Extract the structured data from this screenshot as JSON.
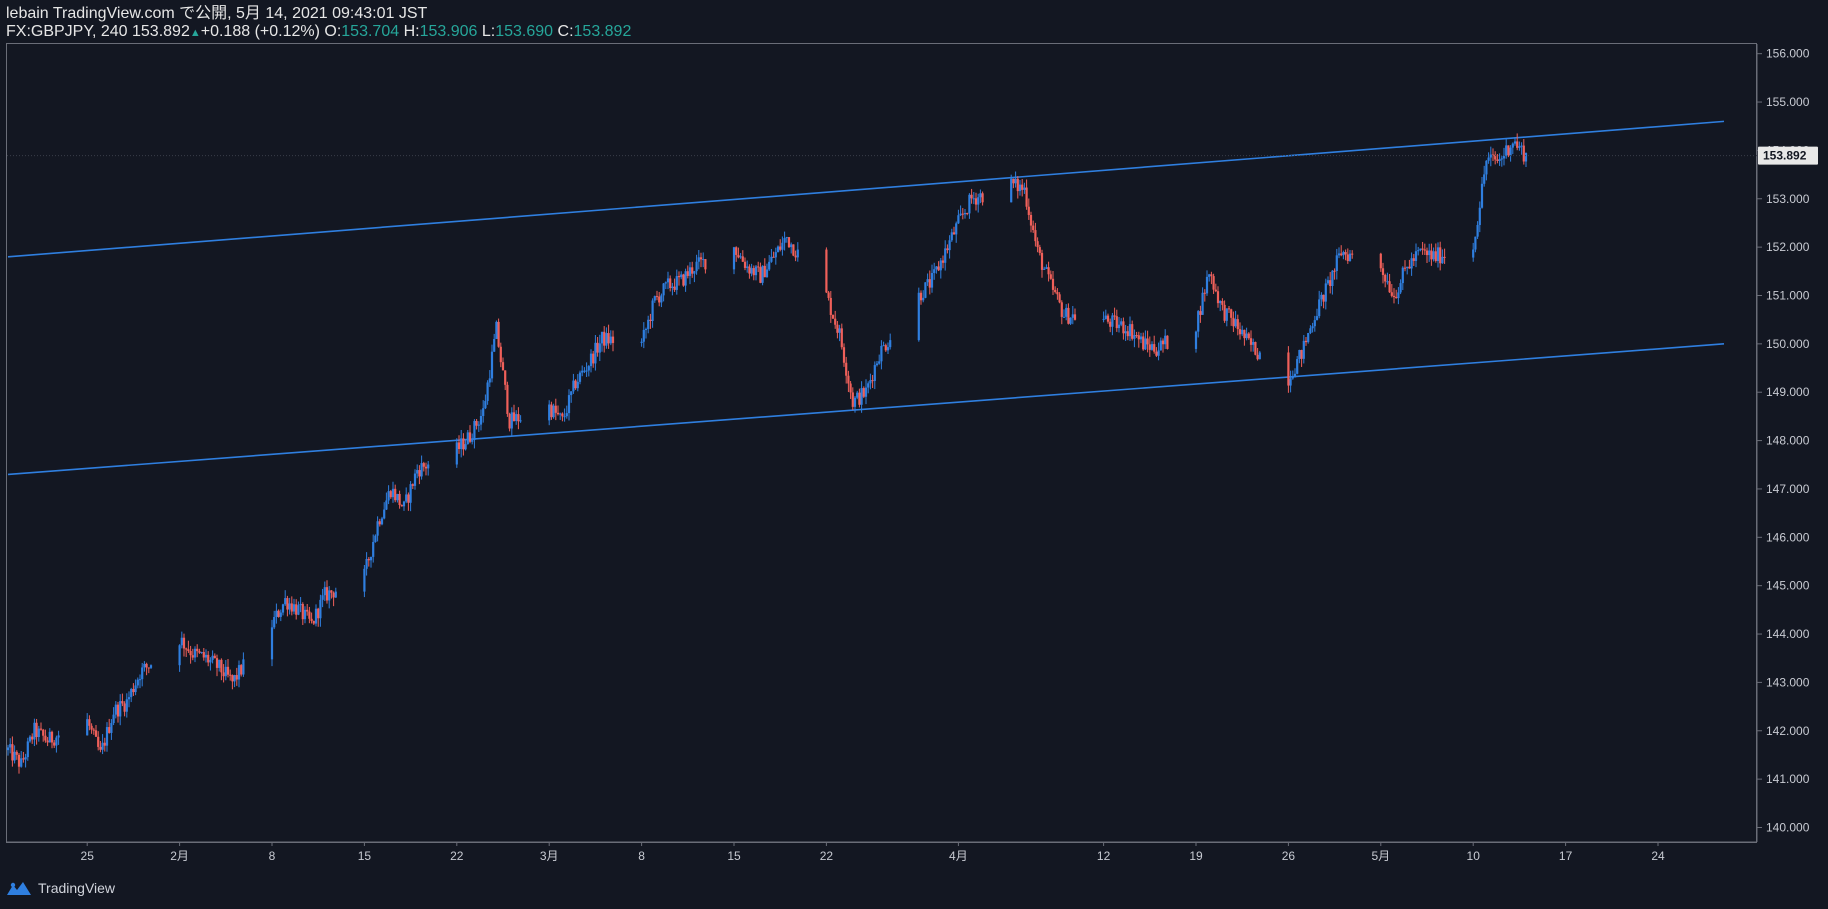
{
  "header": {
    "line1": "lebain TradingView.com で公開, 5月 14, 2021 09:43:01 JST",
    "symbol": "FX:GBPJPY, 240 ",
    "last_price": "153.892",
    "up_arrow": "▲",
    "change": "+0.188 (+0.12%)",
    "o_label": " O:",
    "o_value": "153.704",
    "h_label": " H:",
    "h_value": "153.906",
    "l_label": " L:",
    "l_value": "153.690",
    "c_label": " C:",
    "c_value": "153.892"
  },
  "footer": {
    "brand": "TradingView",
    "logo_icon": "tradingview-logo-icon"
  },
  "colors": {
    "background": "#131722",
    "up": "#2f7fe0",
    "down": "#f0605a",
    "channel": "#2f7fe0",
    "axis_border": "#6a6d78"
  },
  "chart_data": {
    "type": "candlestick",
    "symbol": "FX:GBPJPY",
    "timeframe": "240",
    "ylim": [
      139.7,
      156.2
    ],
    "y_ticks": [
      140,
      141,
      142,
      143,
      144,
      145,
      146,
      147,
      148,
      149,
      150,
      151,
      152,
      153,
      154,
      155,
      156
    ],
    "y_tick_labels": [
      "140.000",
      "141.000",
      "142.000",
      "143.000",
      "144.000",
      "145.000",
      "146.000",
      "147.000",
      "148.000",
      "149.000",
      "150.000",
      "151.000",
      "152.000",
      "153.000",
      "154.000",
      "155.000",
      "156.000"
    ],
    "x_ticks": [
      {
        "label": "25",
        "date": "2021-01-25"
      },
      {
        "label": "2月",
        "date": "2021-02-01"
      },
      {
        "label": "8",
        "date": "2021-02-08"
      },
      {
        "label": "15",
        "date": "2021-02-15"
      },
      {
        "label": "22",
        "date": "2021-02-22"
      },
      {
        "label": "3月",
        "date": "2021-03-01"
      },
      {
        "label": "8",
        "date": "2021-03-08"
      },
      {
        "label": "15",
        "date": "2021-03-15"
      },
      {
        "label": "22",
        "date": "2021-03-22"
      },
      {
        "label": "4月",
        "date": "2021-04-01"
      },
      {
        "label": "12",
        "date": "2021-04-12"
      },
      {
        "label": "19",
        "date": "2021-04-19"
      },
      {
        "label": "26",
        "date": "2021-04-26"
      },
      {
        "label": "5月",
        "date": "2021-05-03"
      },
      {
        "label": "10",
        "date": "2021-05-10"
      },
      {
        "label": "17",
        "date": "2021-05-17"
      },
      {
        "label": "24",
        "date": "2021-05-24"
      }
    ],
    "last_price": 153.892,
    "last_price_label": "153.892",
    "close_path": [
      [
        "2021-01-19",
        141.6
      ],
      [
        "2021-01-20",
        141.3
      ],
      [
        "2021-01-21",
        142.0
      ],
      [
        "2021-01-22",
        141.8
      ],
      [
        "2021-01-25",
        142.2
      ],
      [
        "2021-01-26",
        141.5
      ],
      [
        "2021-01-27",
        142.4
      ],
      [
        "2021-01-28",
        142.6
      ],
      [
        "2021-01-29",
        143.2
      ],
      [
        "2021-02-01",
        143.9
      ],
      [
        "2021-02-02",
        143.6
      ],
      [
        "2021-02-03",
        143.5
      ],
      [
        "2021-02-04",
        143.3
      ],
      [
        "2021-02-05",
        143.0
      ],
      [
        "2021-02-08",
        144.2
      ],
      [
        "2021-02-09",
        144.7
      ],
      [
        "2021-02-10",
        144.5
      ],
      [
        "2021-02-11",
        144.2
      ],
      [
        "2021-02-12",
        144.8
      ],
      [
        "2021-02-15",
        145.2
      ],
      [
        "2021-02-16",
        146.3
      ],
      [
        "2021-02-17",
        147.0
      ],
      [
        "2021-02-18",
        146.6
      ],
      [
        "2021-02-19",
        147.4
      ],
      [
        "2021-02-22",
        147.8
      ],
      [
        "2021-02-23",
        148.1
      ],
      [
        "2021-02-24",
        148.6
      ],
      [
        "2021-02-25",
        150.3
      ],
      [
        "2021-02-26",
        148.4
      ],
      [
        "2021-03-01",
        148.7
      ],
      [
        "2021-03-02",
        148.4
      ],
      [
        "2021-03-03",
        149.2
      ],
      [
        "2021-03-04",
        149.6
      ],
      [
        "2021-03-05",
        150.1
      ],
      [
        "2021-03-08",
        150.0
      ],
      [
        "2021-03-09",
        150.9
      ],
      [
        "2021-03-10",
        151.2
      ],
      [
        "2021-03-11",
        151.3
      ],
      [
        "2021-03-12",
        151.6
      ],
      [
        "2021-03-15",
        152.0
      ],
      [
        "2021-03-16",
        151.6
      ],
      [
        "2021-03-17",
        151.4
      ],
      [
        "2021-03-18",
        151.8
      ],
      [
        "2021-03-19",
        152.2
      ],
      [
        "2021-03-22",
        151.0
      ],
      [
        "2021-03-23",
        150.2
      ],
      [
        "2021-03-24",
        148.8
      ],
      [
        "2021-03-25",
        149.0
      ],
      [
        "2021-03-26",
        149.8
      ],
      [
        "2021-03-29",
        151.0
      ],
      [
        "2021-03-30",
        151.3
      ],
      [
        "2021-03-31",
        151.9
      ],
      [
        "2021-04-01",
        152.5
      ],
      [
        "2021-04-02",
        153.0
      ],
      [
        "2021-04-05",
        153.3
      ],
      [
        "2021-04-06",
        153.2
      ],
      [
        "2021-04-07",
        151.9
      ],
      [
        "2021-04-08",
        151.2
      ],
      [
        "2021-04-09",
        150.6
      ],
      [
        "2021-04-12",
        150.5
      ],
      [
        "2021-04-13",
        150.4
      ],
      [
        "2021-04-14",
        150.3
      ],
      [
        "2021-04-15",
        150.0
      ],
      [
        "2021-04-16",
        149.9
      ],
      [
        "2021-04-19",
        150.4
      ],
      [
        "2021-04-20",
        151.5
      ],
      [
        "2021-04-21",
        150.7
      ],
      [
        "2021-04-22",
        150.4
      ],
      [
        "2021-04-23",
        150.0
      ],
      [
        "2021-04-26",
        149.3
      ],
      [
        "2021-04-27",
        149.8
      ],
      [
        "2021-04-28",
        150.6
      ],
      [
        "2021-04-29",
        151.2
      ],
      [
        "2021-04-30",
        151.9
      ],
      [
        "2021-05-03",
        151.6
      ],
      [
        "2021-05-04",
        151.0
      ],
      [
        "2021-05-05",
        151.6
      ],
      [
        "2021-05-06",
        151.9
      ],
      [
        "2021-05-07",
        151.8
      ],
      [
        "2021-05-10",
        152.0
      ],
      [
        "2021-05-11",
        153.8
      ],
      [
        "2021-05-12",
        153.8
      ],
      [
        "2021-05-13",
        154.2
      ],
      [
        "2021-05-14",
        153.892
      ]
    ],
    "trendlines": [
      {
        "name": "channel-upper",
        "points": [
          [
            "2021-01-19",
            151.8
          ],
          [
            "2021-05-29",
            154.6
          ]
        ]
      },
      {
        "name": "channel-lower",
        "points": [
          [
            "2021-01-19",
            147.3
          ],
          [
            "2021-05-29",
            150.0
          ]
        ]
      }
    ]
  }
}
